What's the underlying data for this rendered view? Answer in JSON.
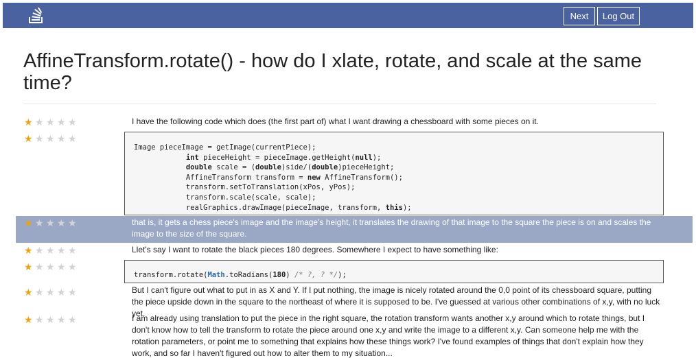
{
  "navbar": {
    "logo_icon": "stack-logo-icon",
    "next_label": "Next",
    "logout_label": "Log Out"
  },
  "title": "AffineTransform.rotate() - how do I xlate, rotate, and scale at the same time?",
  "colors": {
    "navbar": "#4a62a0",
    "star_on": "#f0a30a",
    "star_off": "#d2d2d2",
    "highlight": "#9aa8c6"
  },
  "paragraphs": [
    {
      "rating": 1,
      "text": "I have the following code which does (the first part of) what I want drawing a chessboard with some pieces on it."
    },
    {
      "rating": 1,
      "code": [
        [
          {
            "t": "Image pieceImage = getImage(currentPiece);"
          }
        ],
        [
          {
            "t": "            "
          },
          {
            "t": "int",
            "k": "kw"
          },
          {
            "t": " pieceHeight = pieceImage.getHeight("
          },
          {
            "t": "null",
            "k": "kw"
          },
          {
            "t": ");"
          }
        ],
        [
          {
            "t": "            "
          },
          {
            "t": "double",
            "k": "kw"
          },
          {
            "t": " scale = ("
          },
          {
            "t": "double",
            "k": "kw"
          },
          {
            "t": ")side/("
          },
          {
            "t": "double",
            "k": "kw"
          },
          {
            "t": ")pieceHeight;"
          }
        ],
        [
          {
            "t": "            AffineTransform transform = "
          },
          {
            "t": "new",
            "k": "kw"
          },
          {
            "t": " AffineTransform();"
          }
        ],
        [
          {
            "t": "            transform.setToTranslation(xPos, yPos);"
          }
        ],
        [
          {
            "t": "            transform.scale(scale, scale);"
          }
        ],
        [
          {
            "t": "            realGraphics.drawImage(pieceImage, transform, "
          },
          {
            "t": "this",
            "k": "kw"
          },
          {
            "t": ");"
          }
        ]
      ]
    },
    {
      "rating": 1,
      "highlighted": true,
      "text": "that is, it gets a chess piece's image and the image's height, it translates the drawing of that image to the square the piece is on and scales the image to the size of the square."
    },
    {
      "rating": 1,
      "text": "Llet's say I want to rotate the black pieces 180 degrees. Somewhere I expect to have something like:"
    },
    {
      "rating": 1,
      "code": [
        [
          {
            "t": "transform.rotate("
          },
          {
            "t": "Math",
            "k": "cls"
          },
          {
            "t": ".toRadians("
          },
          {
            "t": "180",
            "k": "num"
          },
          {
            "t": ") "
          },
          {
            "t": "/* ?, ? */",
            "k": "cmt"
          },
          {
            "t": ");"
          }
        ]
      ]
    },
    {
      "rating": 1,
      "text": "But I can't figure out what to put in as X and Y. If I put nothing, the image is nicely rotated around the 0,0 point of its chessboard square, putting the piece upside down in the square to the northeast of where it is supposed to be. I've guessed at various other combinations of x,y, with no luck yet."
    },
    {
      "rating": 1,
      "text": "I am already using translation to put the piece in the right square, the rotation transform wants another x,y around which to rotate things, but I don't know how to tell the transform to rotate the piece around one x,y and write the image to a different x,y. Can someone help me with the rotation parameters, or point me to something that explains how these things work? I've found examples of things that don't explain how they work, and so far I haven't figured out how to alter them to my situation..."
    }
  ]
}
